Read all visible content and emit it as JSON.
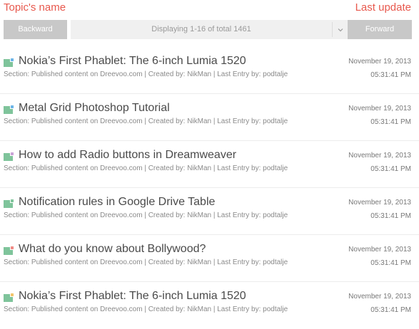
{
  "header": {
    "left_title": "Topic's name",
    "right_title": "Last update",
    "accent_color": "#e8584d"
  },
  "pager": {
    "backward_label": "Backward",
    "forward_label": "Forward",
    "selected_value": "Displaying 1-16 of total 1461",
    "chevron_icon": "chevron-down-icon"
  },
  "topics": [
    {
      "title": "Nokia’s First Phablet: The 6-inch Lumia 1520",
      "meta": "Section: Published content on Dreevoo.com | Created by: NikMan | Last Entry by: podtalje",
      "date": "November 19, 2013",
      "time": "05:31:41 PM",
      "icon_accent": "#6ab4e8"
    },
    {
      "title": "Metal Grid Photoshop Tutorial",
      "meta": "Section: Published content on Dreevoo.com | Created by: NikMan | Last Entry by: podtalje",
      "date": "November 19, 2013",
      "time": "05:31:41 PM",
      "icon_accent": "#6ab4e8"
    },
    {
      "title": "How to add Radio buttons in Dreamweaver",
      "meta": "Section: Published content on Dreevoo.com | Created by: NikMan | Last Entry by: podtalje",
      "date": "November 19, 2013",
      "time": "05:31:41 PM",
      "icon_accent": "#c9a3d6"
    },
    {
      "title": "Notification rules in Google Drive Table",
      "meta": "Section: Published content on Dreevoo.com | Created by: NikMan | Last Entry by: podtalje",
      "date": "November 19, 2013",
      "time": "05:31:41 PM",
      "icon_accent": "#7fc49b"
    },
    {
      "title": "What do you know about Bollywood?",
      "meta": "Section: Published content on Dreevoo.com | Created by: NikMan | Last Entry by: podtalje",
      "date": "November 19, 2013",
      "time": "05:31:41 PM",
      "icon_accent": "#f08a84"
    },
    {
      "title": "Nokia’s First Phablet: The 6-inch Lumia 1520",
      "meta": "Section: Published content on Dreevoo.com | Created by: NikMan | Last Entry by: podtalje",
      "date": "November 19, 2013",
      "time": "05:31:41 PM",
      "icon_accent": "#f2c46a"
    }
  ]
}
